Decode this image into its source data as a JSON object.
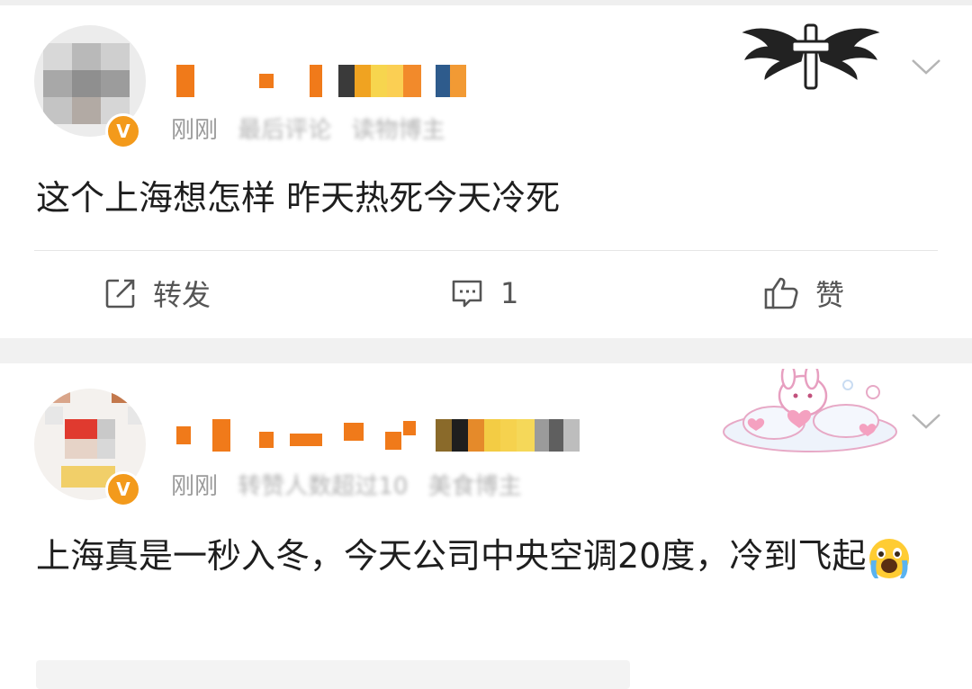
{
  "posts": [
    {
      "meta": {
        "time": "刚刚",
        "note": "最后评论",
        "extra": "读物博主"
      },
      "content": "这个上海想怎样 昨天热死今天冷死",
      "actions": {
        "forward_label": "转发",
        "comment_count": "1",
        "like_label": "赞"
      },
      "badge": "V"
    },
    {
      "meta": {
        "time": "刚刚",
        "note": "转赞人数超过10",
        "extra": "美食博主"
      },
      "content": "上海真是一秒入冬，今天公司中央空调20度，冷到飞起",
      "badge": "V",
      "emoji": "crying-face-emoji"
    }
  ],
  "colors": {
    "verified_badge": "#f39a1b",
    "separator": "#f1f1f1",
    "meta_text": "#9a9a9a"
  },
  "icons": [
    "forward-icon",
    "comment-icon",
    "like-icon",
    "chevron-down-icon",
    "winged-cross-decoration",
    "bunny-cloud-decoration"
  ]
}
